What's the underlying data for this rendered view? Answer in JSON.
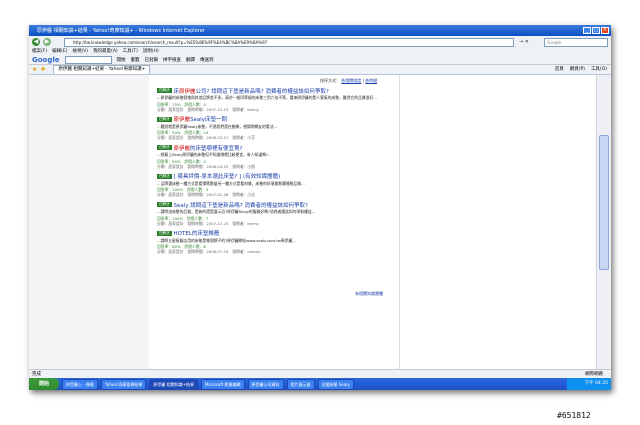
{
  "window": {
    "title": "原伊麗 相關知識+結果 - Yahoo!奇摩知識+ - Windows Internet Explorer",
    "minimize": "_",
    "maximize": "□",
    "close": "×"
  },
  "address_bar": {
    "url": "http://tw.knowledge.yahoo.com/search/search_result?p=%E5%8E%9F%E4%BC%8A%E9%BA%97",
    "go": "→ ✕",
    "search_placeholder": "Google"
  },
  "menu": [
    "檔案(F)",
    "編輯(E)",
    "檢視(V)",
    "我的最愛(A)",
    "工具(T)",
    "說明(H)"
  ],
  "google_bar": {
    "logo": "Google",
    "items": [
      "開始",
      "書籤",
      "已封鎖",
      "拼字檢查",
      "翻譯",
      "傳送到"
    ]
  },
  "tab_bar": {
    "tab_label": "原伊麗 相關知識+結果 - Yahoo!奇摩知識+",
    "tools": [
      "首頁",
      "網頁(P)",
      "工具(O)"
    ]
  },
  "sort": {
    "label": "排序方式：",
    "relevance": "依相關程度",
    "time": "依時間"
  },
  "results": [
    {
      "badge": "已解決",
      "title_parts": [
        "床",
        "原伊麗",
        "公司? 請問這下墊是新品嗎? 消費者的權益該如何爭取?"
      ],
      "snippet": "...原伊麗的床墊價格與其他品牌差不多，高於一般同等級的床墊三到六倍不等，看來原伊麗的是人客氣的床墊，雖然它的品質很好...",
      "meta": "回答率：75%　評價人數：4",
      "meta2": "分類：居家設計　發問時間：2007-12-23　發問者：kenny"
    },
    {
      "badge": "已解決",
      "title_parts": [
        "",
        "原伊麗",
        "Sealy床墊一問"
      ],
      "snippet": "...聽說就是原伊麗Sealy床墊，不過我們還在猶豫，想請問網友的看法...",
      "meta": "回答率：50%　評價人數：24",
      "meta2": "分類：居家設計　發問時間：2008-03-27　發問者：小芳"
    },
    {
      "badge": "已解決",
      "title_parts": [
        "",
        "原伊麗",
        "的床墊哪裡有便宜賣?"
      ],
      "snippet": "...想買上Sealy原伊麗的床墊但不知道哪裡比較便宜，有人知道嗎?...",
      "meta": "回答率：50%　評價人數：4",
      "meta2": "分類：居家設計　發問時間：2008-04-25　發問者：小凱"
    },
    {
      "badge": "已解決",
      "title_parts": [
        "",
        "",
        "[ 寢具評價-原本選此床墊? ] (有效知識團體)"
      ],
      "snippet": "...品牌選床墊一種方式是看彈簧數量另一種方式是看材質，床墊的好壞會影響睡眠品質...",
      "meta": "回答率：100%　評價人數：3",
      "meta2": "分類：居家設計　發問時間：2007-01-28　發問者：小志"
    },
    {
      "badge": "已解決",
      "title_parts": [
        "",
        "",
        "Sealy 請問這下墊是新品嗎? 消費者的權益該如何爭取?"
      ],
      "snippet": "...請問這床墊的品質，是新的還是展示品?原伊麗Sealy的服務好嗎?消費者應該如何爭取權益...",
      "meta": "回答率：100%　評價人數：7",
      "meta2": "分類：居家設計　發問時間：2007-12-23　發問者：kenny"
    },
    {
      "badge": "已解決",
      "title_parts": [
        "",
        "",
        "HOTEL的床墊推薦"
      ],
      "snippet": "...請問五星級飯店用的床墊是哪個牌子的?原伊麗網站www.sealy.com.tw原伊麗...",
      "meta": "回答率：60%　評價人數：8",
      "meta2": "分類：居家設計　發問時間：2008-07-24　發問者：carmin"
    }
  ],
  "related_link": "有相關知識團體",
  "status": {
    "left": "完成",
    "right": "網際網路"
  },
  "taskbar": {
    "start": "開始",
    "buttons": [
      "拼音輸入 - 微軟",
      "Yahoo!奇摩搜尋結果",
      "原伊麗 相關知識+結果",
      "Microsoft 影像編輯",
      "原伊麗公司資料",
      "相片展示器",
      "全國床墊 Sealy"
    ],
    "clock": "下午 04:35"
  },
  "watermark": "#651812"
}
